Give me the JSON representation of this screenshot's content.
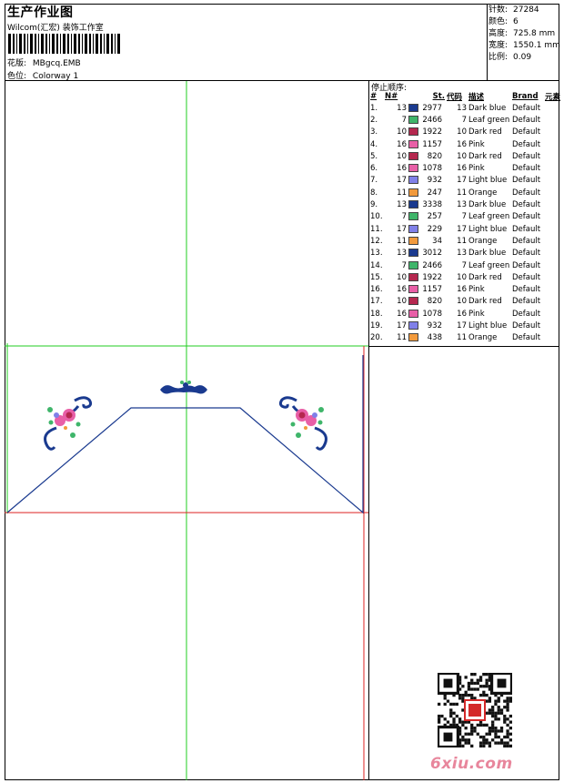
{
  "header": {
    "title": "生产作业图",
    "subtitle": "Wilcom(汇宏) 装饰工作室",
    "design_label": "花版:",
    "design_value": "MBgcq.EMB",
    "colorway_label": "色位:",
    "colorway_value": "Colorway 1"
  },
  "stats": [
    {
      "label": "针数:",
      "value": "27284"
    },
    {
      "label": "颜色:",
      "value": "6"
    },
    {
      "label": "高度:",
      "value": "725.8 mm"
    },
    {
      "label": "宽度:",
      "value": "1550.1 mm"
    },
    {
      "label": "比例:",
      "value": "0.09"
    }
  ],
  "stop_sequence_title": "停止顺序:",
  "table": {
    "headers": [
      "#",
      "N#",
      "St.",
      "代码",
      "描述",
      "Brand",
      "元素"
    ],
    "rows": [
      {
        "idx": "1.",
        "n": "13",
        "color": "#1a3a8f",
        "st": "2977",
        "code": "13",
        "desc": "Dark blue",
        "brand": "Default"
      },
      {
        "idx": "2.",
        "n": "7",
        "color": "#3fb56a",
        "st": "2466",
        "code": "7",
        "desc": "Leaf green",
        "brand": "Default"
      },
      {
        "idx": "3.",
        "n": "10",
        "color": "#b5284f",
        "st": "1922",
        "code": "10",
        "desc": "Dark red",
        "brand": "Default"
      },
      {
        "idx": "4.",
        "n": "16",
        "color": "#e85fa7",
        "st": "1157",
        "code": "16",
        "desc": "Pink",
        "brand": "Default"
      },
      {
        "idx": "5.",
        "n": "10",
        "color": "#b5284f",
        "st": "820",
        "code": "10",
        "desc": "Dark red",
        "brand": "Default"
      },
      {
        "idx": "6.",
        "n": "16",
        "color": "#e85fa7",
        "st": "1078",
        "code": "16",
        "desc": "Pink",
        "brand": "Default"
      },
      {
        "idx": "7.",
        "n": "17",
        "color": "#8080e8",
        "st": "932",
        "code": "17",
        "desc": "Light blue",
        "brand": "Default"
      },
      {
        "idx": "8.",
        "n": "11",
        "color": "#f29a3c",
        "st": "247",
        "code": "11",
        "desc": "Orange",
        "brand": "Default"
      },
      {
        "idx": "9.",
        "n": "13",
        "color": "#1a3a8f",
        "st": "3338",
        "code": "13",
        "desc": "Dark blue",
        "brand": "Default"
      },
      {
        "idx": "10.",
        "n": "7",
        "color": "#3fb56a",
        "st": "257",
        "code": "7",
        "desc": "Leaf green",
        "brand": "Default"
      },
      {
        "idx": "11.",
        "n": "17",
        "color": "#8080e8",
        "st": "229",
        "code": "17",
        "desc": "Light blue",
        "brand": "Default"
      },
      {
        "idx": "12.",
        "n": "11",
        "color": "#f29a3c",
        "st": "34",
        "code": "11",
        "desc": "Orange",
        "brand": "Default"
      },
      {
        "idx": "13.",
        "n": "13",
        "color": "#1a3a8f",
        "st": "3012",
        "code": "13",
        "desc": "Dark blue",
        "brand": "Default"
      },
      {
        "idx": "14.",
        "n": "7",
        "color": "#3fb56a",
        "st": "2466",
        "code": "7",
        "desc": "Leaf green",
        "brand": "Default"
      },
      {
        "idx": "15.",
        "n": "10",
        "color": "#b5284f",
        "st": "1922",
        "code": "10",
        "desc": "Dark red",
        "brand": "Default"
      },
      {
        "idx": "16.",
        "n": "16",
        "color": "#e85fa7",
        "st": "1157",
        "code": "16",
        "desc": "Pink",
        "brand": "Default"
      },
      {
        "idx": "17.",
        "n": "10",
        "color": "#b5284f",
        "st": "820",
        "code": "10",
        "desc": "Dark red",
        "brand": "Default"
      },
      {
        "idx": "18.",
        "n": "16",
        "color": "#e85fa7",
        "st": "1078",
        "code": "16",
        "desc": "Pink",
        "brand": "Default"
      },
      {
        "idx": "19.",
        "n": "17",
        "color": "#8080e8",
        "st": "932",
        "code": "17",
        "desc": "Light blue",
        "brand": "Default"
      },
      {
        "idx": "20.",
        "n": "11",
        "color": "#f29a3c",
        "st": "438",
        "code": "11",
        "desc": "Orange",
        "brand": "Default"
      }
    ]
  },
  "colors": {
    "guide_green": "#22cc22",
    "guide_red": "#dd2222",
    "outline_blue": "#1a3a8f",
    "watermark_pink": "#e8869c"
  },
  "icons": {
    "qr": "qr-code-icon",
    "seal": "red-seal-icon"
  },
  "watermark": "6xiu.com"
}
